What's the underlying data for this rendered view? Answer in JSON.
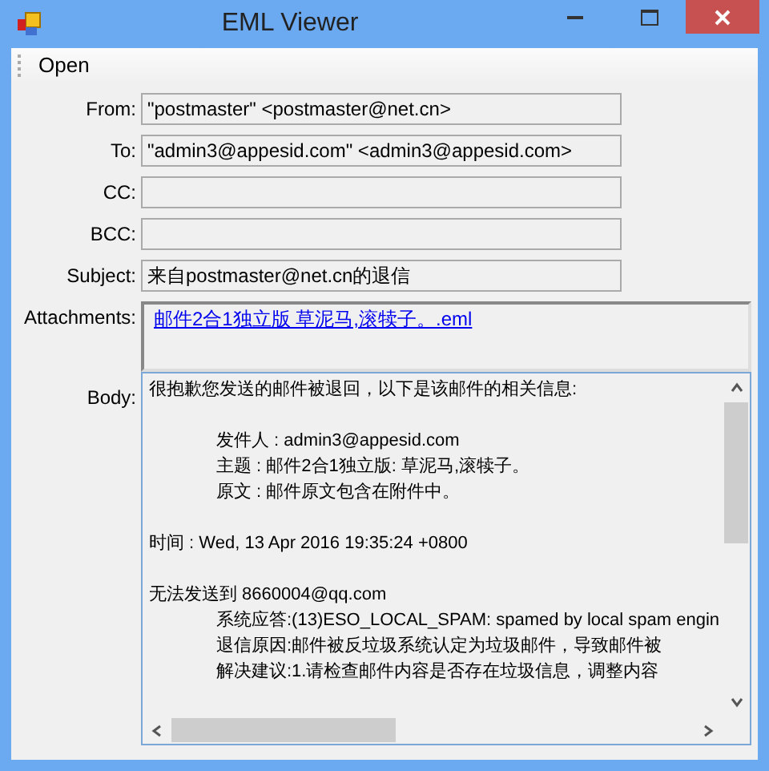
{
  "window": {
    "title": "EML Viewer"
  },
  "menu": [
    "Open"
  ],
  "fields": [
    {
      "label": "From:",
      "value": "\"postmaster\" <postmaster@net.cn>"
    },
    {
      "label": "To:",
      "value": "\"admin3@appesid.com\" <admin3@appesid.com>"
    },
    {
      "label": "CC:"
    },
    {
      "label": "BCC:"
    },
    {
      "label": "Subject:",
      "value": "来自postmaster@net.cn的退信"
    }
  ],
  "attachments": {
    "label": "Attachments:",
    "items": [
      "邮件2合1独立版  草泥马,滚犊子。.eml"
    ]
  },
  "body": {
    "label": "Body:",
    "lines": [
      {
        "text": "很抱歉您发送的邮件被退回，以下是该邮件的相关信息:",
        "indent": false,
        "space_before": false
      },
      {
        "text": "发件人 : admin3@appesid.com",
        "indent": true,
        "space_before": true
      },
      {
        "text": "主题 : 邮件2合1独立版: 草泥马,滚犊子。",
        "indent": true,
        "space_before": false
      },
      {
        "text": "原文 : 邮件原文包含在附件中。",
        "indent": true,
        "space_before": false
      },
      {
        "text": "时间 : Wed, 13 Apr 2016 19:35:24 +0800",
        "indent": false,
        "space_before": true
      },
      {
        "text": "无法发送到 8660004@qq.com",
        "indent": false,
        "space_before": true
      },
      {
        "text": "系统应答:(13)ESO_LOCAL_SPAM: spamed by local spam engin",
        "indent": true,
        "space_before": false
      },
      {
        "text": "退信原因:邮件被反垃圾系统认定为垃圾邮件，导致邮件被",
        "indent": true,
        "space_before": false
      },
      {
        "text": "解决建议:1.请检查邮件内容是否存在垃圾信息，调整内容",
        "indent": true,
        "space_before": false
      }
    ]
  }
}
